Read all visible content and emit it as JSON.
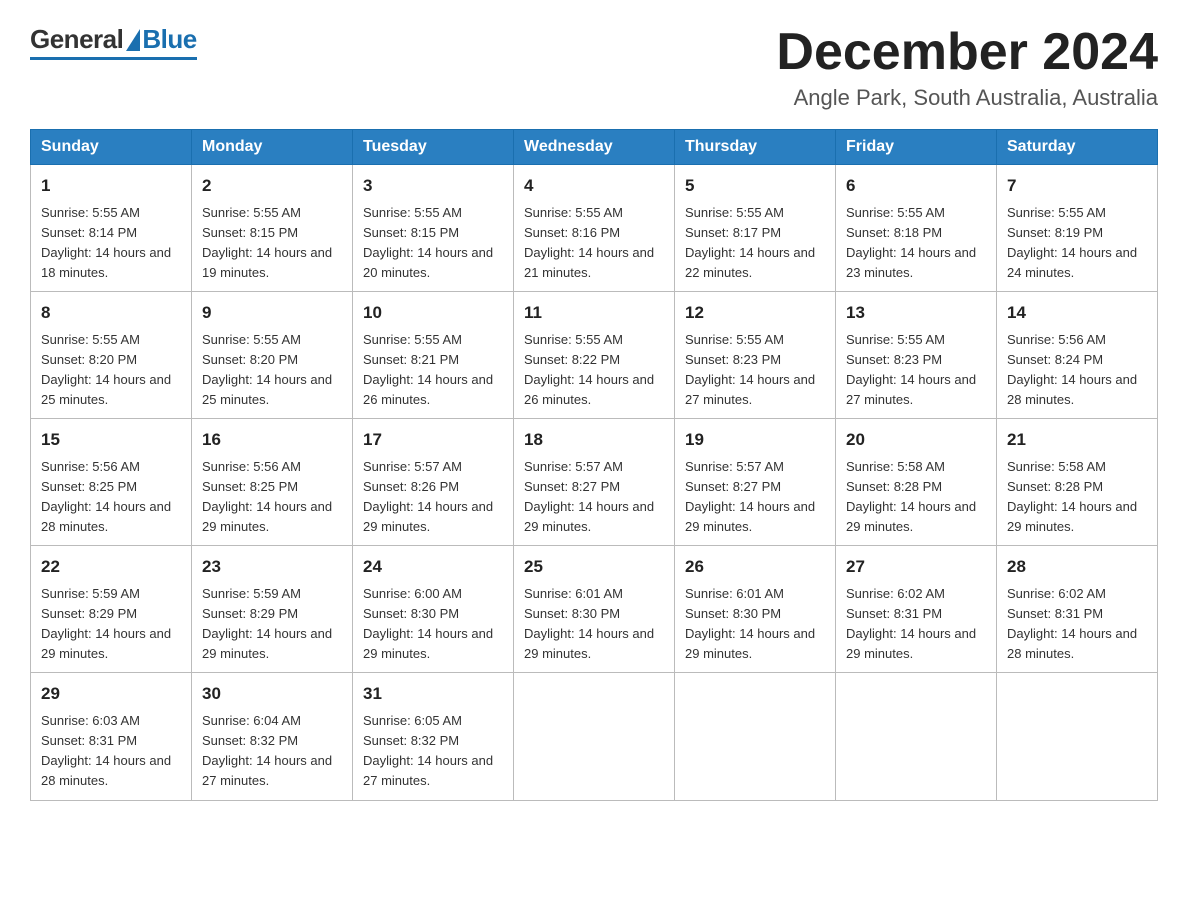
{
  "header": {
    "logo_general": "General",
    "logo_blue": "Blue",
    "month_title": "December 2024",
    "location": "Angle Park, South Australia, Australia"
  },
  "weekdays": [
    "Sunday",
    "Monday",
    "Tuesday",
    "Wednesday",
    "Thursday",
    "Friday",
    "Saturday"
  ],
  "weeks": [
    [
      {
        "day": 1,
        "sunrise": "5:55 AM",
        "sunset": "8:14 PM",
        "daylight": "14 hours and 18 minutes."
      },
      {
        "day": 2,
        "sunrise": "5:55 AM",
        "sunset": "8:15 PM",
        "daylight": "14 hours and 19 minutes."
      },
      {
        "day": 3,
        "sunrise": "5:55 AM",
        "sunset": "8:15 PM",
        "daylight": "14 hours and 20 minutes."
      },
      {
        "day": 4,
        "sunrise": "5:55 AM",
        "sunset": "8:16 PM",
        "daylight": "14 hours and 21 minutes."
      },
      {
        "day": 5,
        "sunrise": "5:55 AM",
        "sunset": "8:17 PM",
        "daylight": "14 hours and 22 minutes."
      },
      {
        "day": 6,
        "sunrise": "5:55 AM",
        "sunset": "8:18 PM",
        "daylight": "14 hours and 23 minutes."
      },
      {
        "day": 7,
        "sunrise": "5:55 AM",
        "sunset": "8:19 PM",
        "daylight": "14 hours and 24 minutes."
      }
    ],
    [
      {
        "day": 8,
        "sunrise": "5:55 AM",
        "sunset": "8:20 PM",
        "daylight": "14 hours and 25 minutes."
      },
      {
        "day": 9,
        "sunrise": "5:55 AM",
        "sunset": "8:20 PM",
        "daylight": "14 hours and 25 minutes."
      },
      {
        "day": 10,
        "sunrise": "5:55 AM",
        "sunset": "8:21 PM",
        "daylight": "14 hours and 26 minutes."
      },
      {
        "day": 11,
        "sunrise": "5:55 AM",
        "sunset": "8:22 PM",
        "daylight": "14 hours and 26 minutes."
      },
      {
        "day": 12,
        "sunrise": "5:55 AM",
        "sunset": "8:23 PM",
        "daylight": "14 hours and 27 minutes."
      },
      {
        "day": 13,
        "sunrise": "5:55 AM",
        "sunset": "8:23 PM",
        "daylight": "14 hours and 27 minutes."
      },
      {
        "day": 14,
        "sunrise": "5:56 AM",
        "sunset": "8:24 PM",
        "daylight": "14 hours and 28 minutes."
      }
    ],
    [
      {
        "day": 15,
        "sunrise": "5:56 AM",
        "sunset": "8:25 PM",
        "daylight": "14 hours and 28 minutes."
      },
      {
        "day": 16,
        "sunrise": "5:56 AM",
        "sunset": "8:25 PM",
        "daylight": "14 hours and 29 minutes."
      },
      {
        "day": 17,
        "sunrise": "5:57 AM",
        "sunset": "8:26 PM",
        "daylight": "14 hours and 29 minutes."
      },
      {
        "day": 18,
        "sunrise": "5:57 AM",
        "sunset": "8:27 PM",
        "daylight": "14 hours and 29 minutes."
      },
      {
        "day": 19,
        "sunrise": "5:57 AM",
        "sunset": "8:27 PM",
        "daylight": "14 hours and 29 minutes."
      },
      {
        "day": 20,
        "sunrise": "5:58 AM",
        "sunset": "8:28 PM",
        "daylight": "14 hours and 29 minutes."
      },
      {
        "day": 21,
        "sunrise": "5:58 AM",
        "sunset": "8:28 PM",
        "daylight": "14 hours and 29 minutes."
      }
    ],
    [
      {
        "day": 22,
        "sunrise": "5:59 AM",
        "sunset": "8:29 PM",
        "daylight": "14 hours and 29 minutes."
      },
      {
        "day": 23,
        "sunrise": "5:59 AM",
        "sunset": "8:29 PM",
        "daylight": "14 hours and 29 minutes."
      },
      {
        "day": 24,
        "sunrise": "6:00 AM",
        "sunset": "8:30 PM",
        "daylight": "14 hours and 29 minutes."
      },
      {
        "day": 25,
        "sunrise": "6:01 AM",
        "sunset": "8:30 PM",
        "daylight": "14 hours and 29 minutes."
      },
      {
        "day": 26,
        "sunrise": "6:01 AM",
        "sunset": "8:30 PM",
        "daylight": "14 hours and 29 minutes."
      },
      {
        "day": 27,
        "sunrise": "6:02 AM",
        "sunset": "8:31 PM",
        "daylight": "14 hours and 29 minutes."
      },
      {
        "day": 28,
        "sunrise": "6:02 AM",
        "sunset": "8:31 PM",
        "daylight": "14 hours and 28 minutes."
      }
    ],
    [
      {
        "day": 29,
        "sunrise": "6:03 AM",
        "sunset": "8:31 PM",
        "daylight": "14 hours and 28 minutes."
      },
      {
        "day": 30,
        "sunrise": "6:04 AM",
        "sunset": "8:32 PM",
        "daylight": "14 hours and 27 minutes."
      },
      {
        "day": 31,
        "sunrise": "6:05 AM",
        "sunset": "8:32 PM",
        "daylight": "14 hours and 27 minutes."
      },
      null,
      null,
      null,
      null
    ]
  ]
}
